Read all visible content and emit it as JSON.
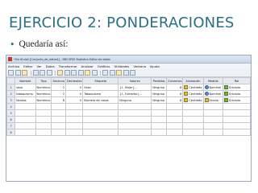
{
  "slide": {
    "title": "EJERCICIO 2: PONDERACIONES",
    "bullet": "Quedaría así:"
  },
  "app": {
    "window_title": "*Sin título2 [Conjunto_de_datos1] - IBM SPSS Statistics Editor de datos",
    "menu": [
      "Archivo",
      "Editar",
      "Ver",
      "Datos",
      "Transformar",
      "Analizar",
      "Gráficos",
      "Utilidades",
      "Ventana",
      "Ayuda"
    ],
    "toolbar_icons": [
      "open-icon",
      "save-icon",
      "print-icon",
      "dialog-recall-icon",
      "undo-icon",
      "redo-icon",
      "goto-case-icon",
      "goto-variable-icon",
      "variables-icon",
      "find-icon",
      "insert-cases-icon",
      "insert-variable-icon",
      "split-file-icon",
      "weight-cases-icon",
      "select-cases-icon",
      "value-labels-icon",
      "use-sets-icon"
    ],
    "columns": [
      "",
      "Nombre",
      "Tipo",
      "Anchura",
      "Decimales",
      "Etiqueta",
      "Valores",
      "Perdidos",
      "Columnas",
      "Alineación",
      "Medida",
      "Rol"
    ],
    "rows": [
      {
        "num": "1",
        "nombre": "sexo",
        "tipo": "Numérico",
        "anchura": "2",
        "decimales": "0",
        "etiqueta": "Sexo",
        "valores": "{1, Mujer}...",
        "perdidos": "Ninguna",
        "columnas": "8",
        "alineacion": "Centrado",
        "medida": "Nominal",
        "rol": "Entrada"
      },
      {
        "num": "2",
        "nombre": "tabaquismo",
        "tipo": "Numérico",
        "anchura": "2",
        "decimales": "0",
        "etiqueta": "Tabaquismo",
        "valores": "{1, Fumador}...",
        "perdidos": "Ninguna",
        "columnas": "8",
        "alineacion": "Centrado",
        "medida": "Nominal",
        "rol": "Entrada"
      },
      {
        "num": "3",
        "nombre": "Ncasos",
        "tipo": "Numérico",
        "anchura": "8",
        "decimales": "0",
        "etiqueta": "Número de casos",
        "valores": "Ninguna",
        "perdidos": "Ninguna",
        "columnas": "8",
        "alineacion": "Centrado",
        "medida": "Escala",
        "rol": "Entrada"
      },
      {
        "num": "4"
      },
      {
        "num": "5"
      },
      {
        "num": "6"
      },
      {
        "num": "7"
      },
      {
        "num": "8"
      }
    ]
  },
  "colors": {
    "title": "#2b6f86",
    "header_bg": "#e6eaf0",
    "titlebar": "#c6d5e8"
  }
}
